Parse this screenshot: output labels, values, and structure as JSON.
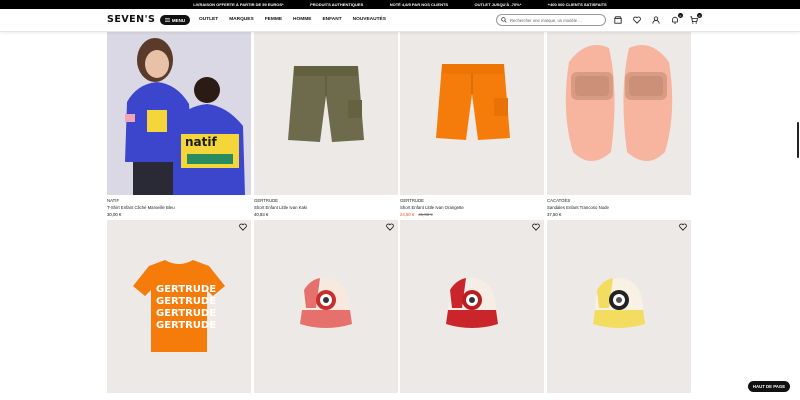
{
  "promo_bar": [
    "LIVRAISON OFFERTE À PARTIR DE 59 EUROS*",
    "PRODUITS AUTHENTIQUES",
    "NOTÉ 4,8/5 PAR NOS CLIENTS",
    "OUTLET JUSQU'À -70%*",
    "+400 000 CLIENTS SATISFAITS"
  ],
  "header": {
    "logo": "SEVEN'S",
    "menu_label": "MENU",
    "nav": [
      "OUTLET",
      "MARQUES",
      "FEMME",
      "HOMME",
      "ENFANT",
      "NOUVEAUTÉS"
    ],
    "search_placeholder": "Rechercher une marque, un modèle ...",
    "wishlist_count": "0",
    "cart_count": "0"
  },
  "products": [
    {
      "brand": "NATIF",
      "name": "T-Shirt Enfant Cliché Marseille Bleu",
      "price": "30,00 €",
      "old_price": "",
      "image": "kids-tshirt-blue"
    },
    {
      "brand": "GERTRUDE",
      "name": "Short Enfant Little Ivan Kaki",
      "price": "40,83 €",
      "old_price": "",
      "image": "shorts-khaki"
    },
    {
      "brand": "GERTRUDE",
      "name": "Short Enfant Little Ivan Orangette",
      "price": "24,50 €",
      "old_price": "41,83 €",
      "image": "shorts-orange"
    },
    {
      "brand": "CACATOÈS",
      "name": "Sandales Enfant Trancoso Nude",
      "price": "37,50 €",
      "old_price": "",
      "image": "sandals-nude"
    },
    {
      "brand": "",
      "name": "",
      "price": "",
      "old_price": "",
      "image": "tshirt-orange-gertrude"
    },
    {
      "brand": "",
      "name": "",
      "price": "",
      "old_price": "",
      "image": "cap-pink"
    },
    {
      "brand": "",
      "name": "",
      "price": "",
      "old_price": "",
      "image": "cap-red"
    },
    {
      "brand": "",
      "name": "",
      "price": "",
      "old_price": "",
      "image": "cap-yellow"
    }
  ],
  "tshirt_print": [
    "GERTRUDE",
    "GERTRUDE",
    "GERTRUDE",
    "GERTRUDE"
  ],
  "scroll_top_label": "HAUT DE PAGE",
  "colors": {
    "sale": "#e8502e",
    "orange": "#f57c00",
    "khaki": "#6b6a4a",
    "blue": "#3a48c9"
  }
}
